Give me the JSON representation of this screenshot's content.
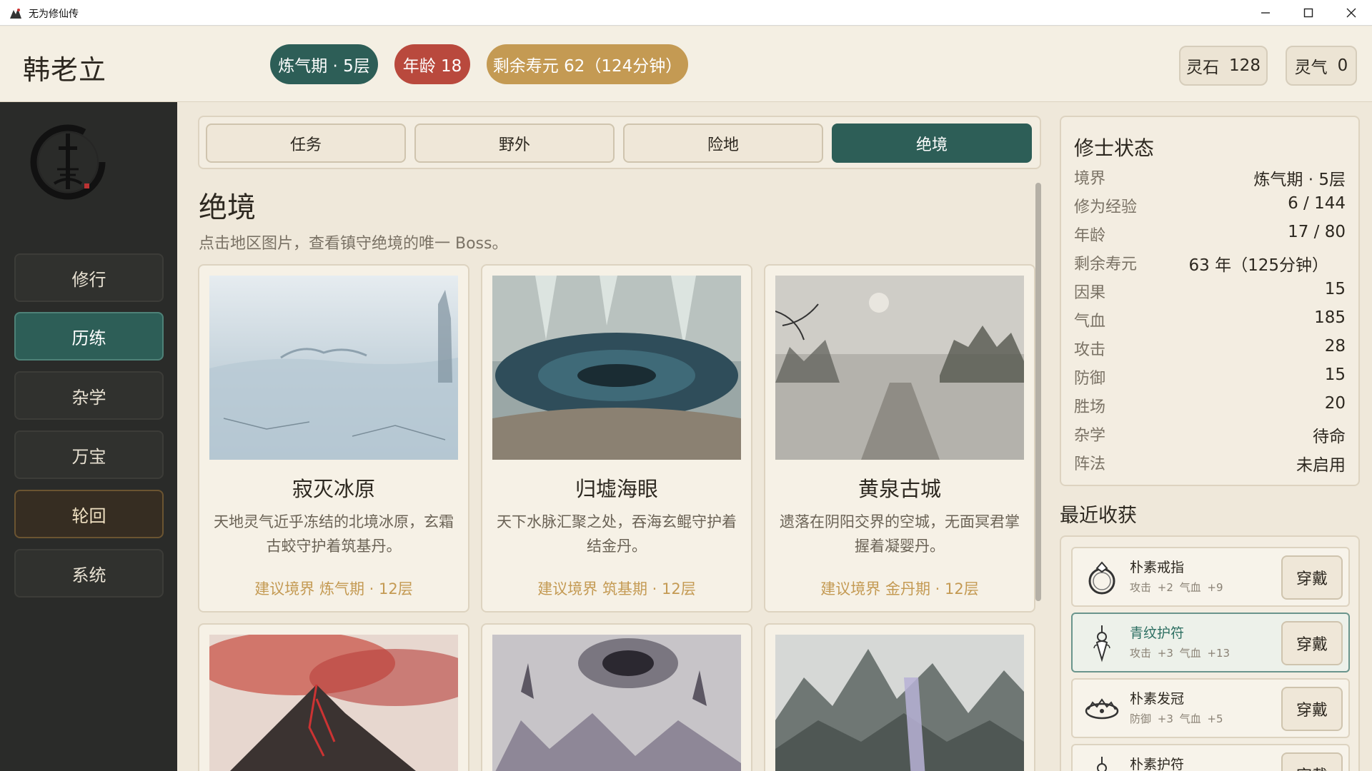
{
  "window": {
    "title": "无为修仙传",
    "icon": "app-logo-icon",
    "controls": [
      "minimize-icon",
      "maximize-icon",
      "close-icon"
    ]
  },
  "header": {
    "player_name": "韩老立",
    "realm_pill": "炼气期 · 5层",
    "age_pill": "年龄 18",
    "life_pill": "剩余寿元 62（124分钟）",
    "spirit_stone_label": "灵石",
    "spirit_stone_value": "128",
    "spirit_qi_label": "灵气",
    "spirit_qi_value": "0"
  },
  "sidebar": {
    "items": [
      {
        "label": "修行"
      },
      {
        "label": "历练",
        "active": true
      },
      {
        "label": "杂学"
      },
      {
        "label": "万宝"
      },
      {
        "label": "轮回"
      },
      {
        "label": "系统"
      }
    ]
  },
  "tabs": [
    {
      "label": "任务"
    },
    {
      "label": "野外"
    },
    {
      "label": "险地"
    },
    {
      "label": "绝境",
      "active": true
    }
  ],
  "main": {
    "title": "绝境",
    "description": "点击地区图片，查看镇守绝境的唯一 Boss。",
    "cards": [
      {
        "name": "寂灭冰原",
        "desc": "天地灵气近乎冻结的北境冰原，玄霜古蛟守护着筑基丹。",
        "recommend": "建议境界 炼气期 · 12层"
      },
      {
        "name": "归墟海眼",
        "desc": "天下水脉汇聚之处，吞海玄鲲守护着结金丹。",
        "recommend": "建议境界 筑基期 · 12层"
      },
      {
        "name": "黄泉古城",
        "desc": "遗落在阴阳交界的空城，无面冥君掌握着凝婴丹。",
        "recommend": "建议境界 金丹期 · 12层"
      }
    ]
  },
  "status": {
    "title": "修士状态",
    "rows": [
      {
        "k": "境界",
        "v": "炼气期 · 5层"
      },
      {
        "k": "修为经验",
        "v": "6 / 144"
      },
      {
        "k": "年龄",
        "v": "17 / 80"
      },
      {
        "k": "剩余寿元",
        "v": "63 年（125分钟）"
      },
      {
        "k": "因果",
        "v": "15"
      },
      {
        "k": "气血",
        "v": "185"
      },
      {
        "k": "攻击",
        "v": "28"
      },
      {
        "k": "防御",
        "v": "15"
      },
      {
        "k": "胜场",
        "v": "20"
      },
      {
        "k": "杂学",
        "v": "待命"
      },
      {
        "k": "阵法",
        "v": "未启用"
      }
    ]
  },
  "loot": {
    "title": "最近收获",
    "wear_label": "穿戴",
    "items": [
      {
        "name": "朴素戒指",
        "stats": "攻击 +2  气血 +9",
        "icon": "ring-icon"
      },
      {
        "name": "青纹护符",
        "stats": "攻击 +3  气血 +13",
        "icon": "amulet-icon",
        "highlight": true
      },
      {
        "name": "朴素发冠",
        "stats": "防御 +3  气血 +5",
        "icon": "crown-icon"
      },
      {
        "name": "朴素护符",
        "stats": "",
        "icon": "amulet-icon"
      }
    ]
  },
  "colors": {
    "accent": "#2d5e57",
    "age_red": "#b9493d",
    "gold": "#c49a53",
    "sidebar_bg": "#2a2b29",
    "page_bg": "#efe8da"
  }
}
